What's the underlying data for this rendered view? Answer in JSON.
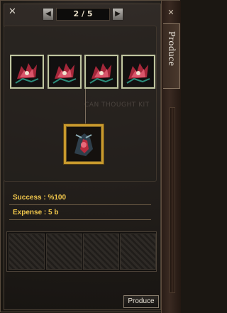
{
  "window": {
    "close_glyph": "✕"
  },
  "pager": {
    "prev_glyph": "◀",
    "next_glyph": "▶",
    "label": "2 / 5"
  },
  "watermark": "CAN THOUGHT KIT",
  "ingredients": [
    {
      "icon": "red-dragon-item-icon"
    },
    {
      "icon": "red-dragon-item-icon"
    },
    {
      "icon": "red-dragon-item-icon"
    },
    {
      "icon": "red-dragon-item-icon"
    }
  ],
  "result": {
    "icon": "dragon-helm-item-icon"
  },
  "info": {
    "success": "Success : %100",
    "expense": "Expense : 5 b"
  },
  "actions": {
    "produce": "Produce"
  },
  "side_tab": {
    "label": "Produce",
    "close_glyph": "✕"
  },
  "colors": {
    "accent_gold": "#c99a2d",
    "info_text": "#f2c84c",
    "slot_border": "#bfc5a0"
  }
}
